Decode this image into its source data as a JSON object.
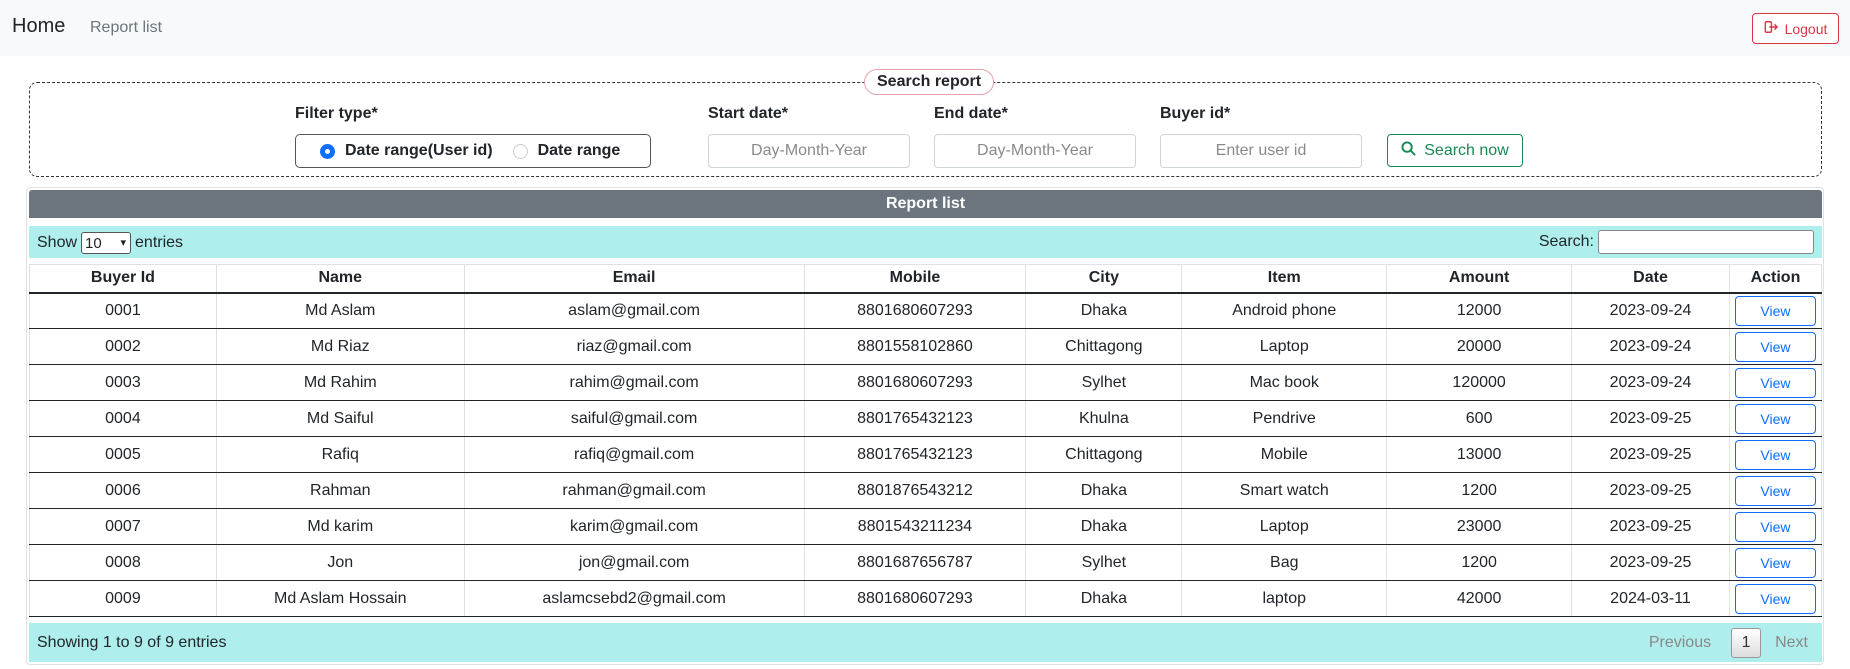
{
  "navbar": {
    "brand": "Home",
    "link": "Report list",
    "logout_label": "Logout",
    "logout_icon": "sign-out-icon"
  },
  "search": {
    "legend": "Search report",
    "filter_label": "Filter type*",
    "filter_options": [
      "Date range(User id)",
      "Date range"
    ],
    "filter_selected": "Date range(User id)",
    "start_label": "Start date*",
    "start_placeholder": "Day-Month-Year",
    "end_label": "End date*",
    "end_placeholder": "Day-Month-Year",
    "buyer_label": "Buyer id*",
    "buyer_placeholder": "Enter user id",
    "button_label": "Search now",
    "button_icon": "search-icon"
  },
  "report": {
    "header": "Report list",
    "show_prefix": "Show",
    "show_value": "10",
    "show_suffix": "entries",
    "search_label": "Search:",
    "columns": [
      "Buyer Id",
      "Name",
      "Email",
      "Mobile",
      "City",
      "Item",
      "Amount",
      "Date",
      "Action"
    ],
    "rows": [
      [
        "0001",
        "Md Aslam",
        "aslam@gmail.com",
        "8801680607293",
        "Dhaka",
        "Android phone",
        "12000",
        "2023-09-24",
        "View"
      ],
      [
        "0002",
        "Md Riaz",
        "riaz@gmail.com",
        "8801558102860",
        "Chittagong",
        "Laptop",
        "20000",
        "2023-09-24",
        "View"
      ],
      [
        "0003",
        "Md Rahim",
        "rahim@gmail.com",
        "8801680607293",
        "Sylhet",
        "Mac book",
        "120000",
        "2023-09-24",
        "View"
      ],
      [
        "0004",
        "Md Saiful",
        "saiful@gmail.com",
        "8801765432123",
        "Khulna",
        "Pendrive",
        "600",
        "2023-09-25",
        "View"
      ],
      [
        "0005",
        "Rafiq",
        "rafiq@gmail.com",
        "8801765432123",
        "Chittagong",
        "Mobile",
        "13000",
        "2023-09-25",
        "View"
      ],
      [
        "0006",
        "Rahman",
        "rahman@gmail.com",
        "8801876543212",
        "Dhaka",
        "Smart watch",
        "1200",
        "2023-09-25",
        "View"
      ],
      [
        "0007",
        "Md karim",
        "karim@gmail.com",
        "8801543211234",
        "Dhaka",
        "Laptop",
        "23000",
        "2023-09-25",
        "View"
      ],
      [
        "0008",
        "Jon",
        "jon@gmail.com",
        "8801687656787",
        "Sylhet",
        "Bag",
        "1200",
        "2023-09-25",
        "View"
      ],
      [
        "0009",
        "Md Aslam Hossain",
        "aslamcsebd2@gmail.com",
        "8801680607293",
        "Dhaka",
        "laptop",
        "42000",
        "2024-03-11",
        "View"
      ]
    ],
    "info": "Showing 1 to 9 of 9 entries",
    "prev_label": "Previous",
    "page": "1",
    "next_label": "Next"
  },
  "colors": {
    "header_bg": "#6c757d",
    "toolbar_bg": "#aeeeed",
    "logout": "#dc3545",
    "search_btn": "#198754",
    "view_btn": "#0d6efd"
  }
}
